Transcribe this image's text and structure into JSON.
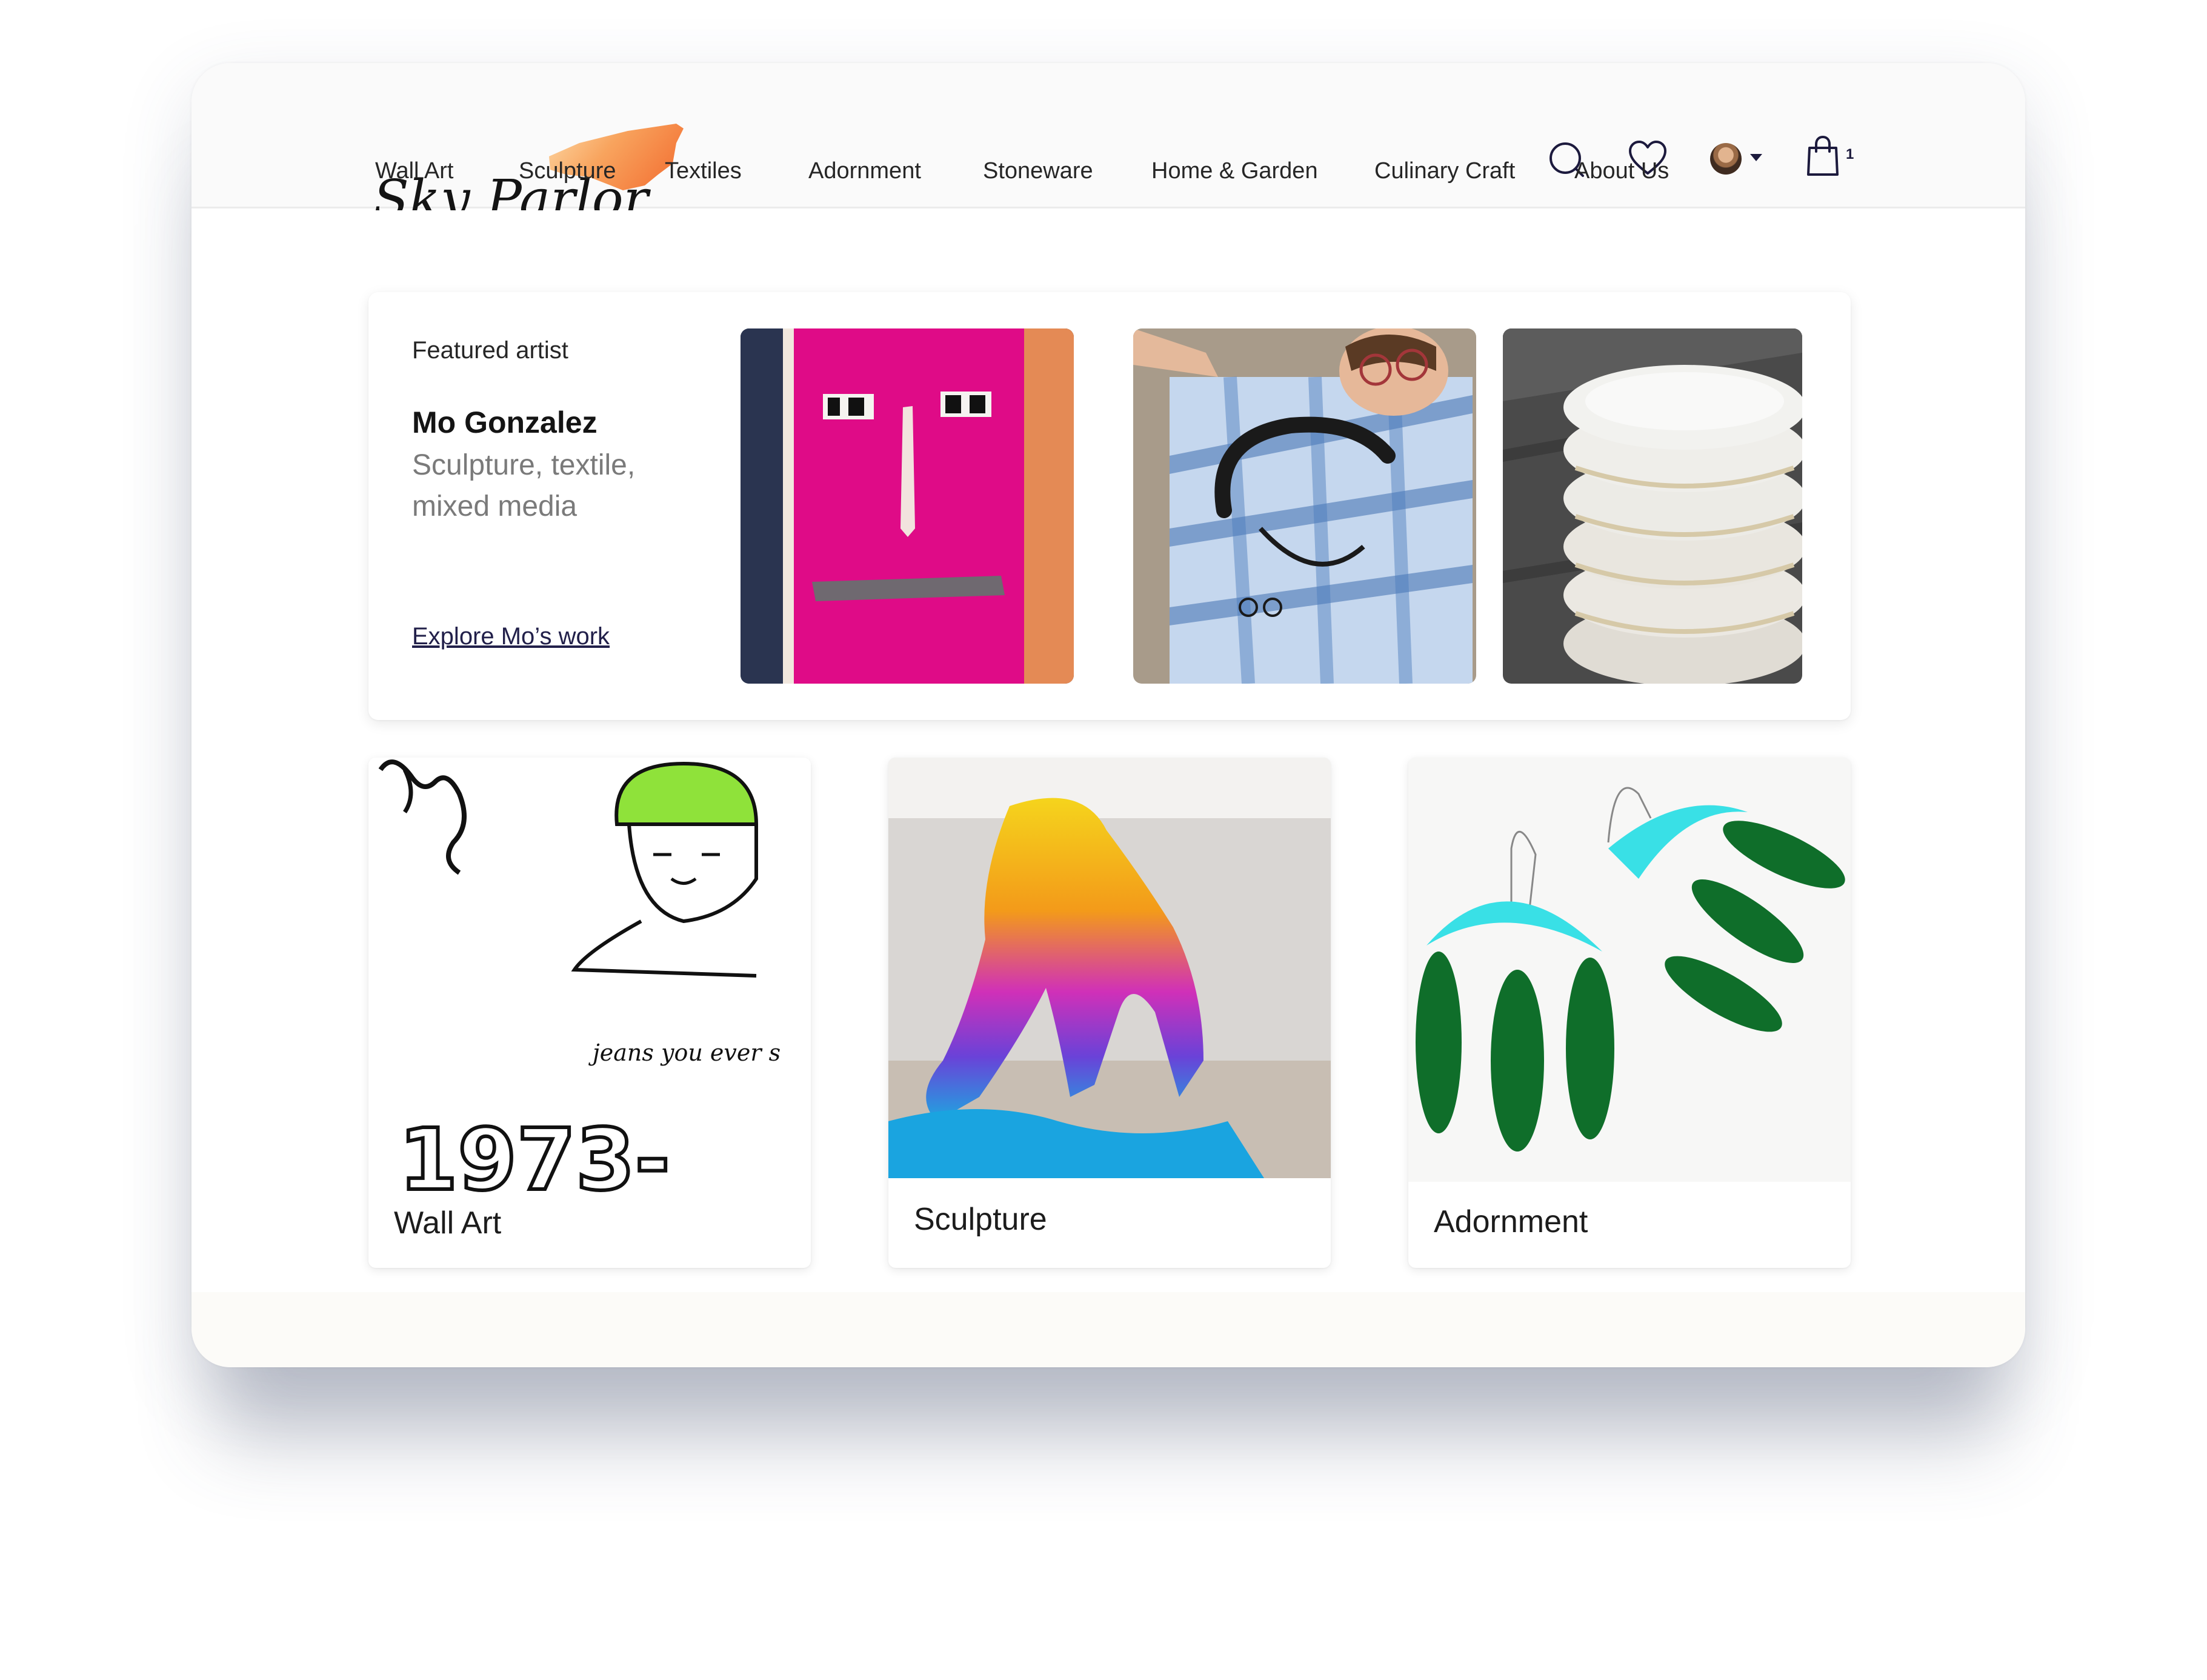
{
  "header": {
    "logo_text": "Sky Parlor",
    "icons": [
      "search-icon",
      "heart-icon",
      "avatar",
      "chevron-down-icon",
      "shopping-bag-icon"
    ],
    "cart_count": "1",
    "brand_color": "#f7934a"
  },
  "nav": {
    "items": [
      {
        "label": "Wall Art"
      },
      {
        "label": "Sculpture"
      },
      {
        "label": "Textiles"
      },
      {
        "label": "Adornment"
      },
      {
        "label": "Stoneware"
      },
      {
        "label": "Home & Garden"
      },
      {
        "label": "Culinary Craft"
      },
      {
        "label": "About Us"
      }
    ]
  },
  "featured": {
    "label": "Featured artist",
    "artist_name": "Mo Gonzalez",
    "disciplines": "Sculpture, textile, mixed media",
    "link_text": "Explore Mo’s work"
  },
  "categories": [
    {
      "label": "Wall Art"
    },
    {
      "label": "Sculpture"
    },
    {
      "label": "Adornment"
    }
  ],
  "artwork_text": {
    "handwriting": "jeans you ever s",
    "year": "1973-"
  },
  "colors": {
    "text": "#141414",
    "muted": "#7a7a7a",
    "link": "#22204a",
    "header_bg": "#fafafa"
  }
}
